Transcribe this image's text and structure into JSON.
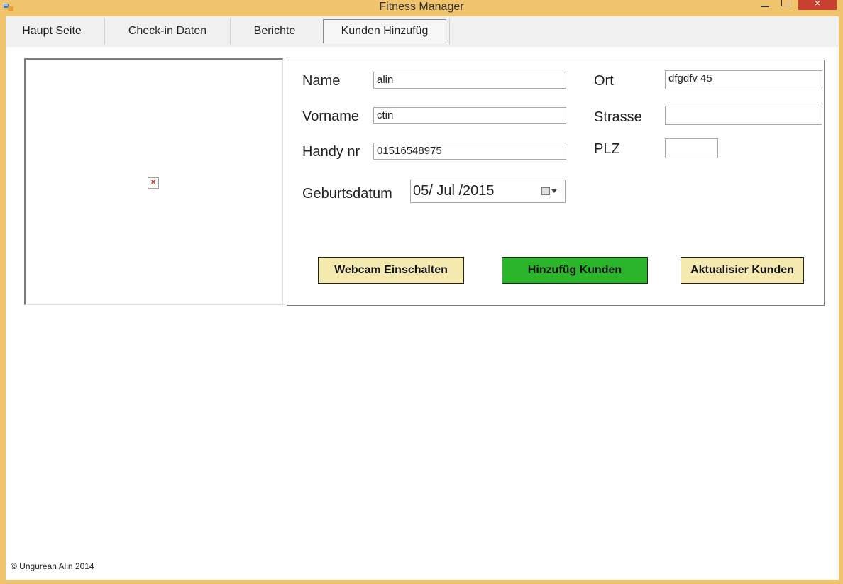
{
  "window": {
    "title": "Fitness Manager",
    "close_glyph": "×"
  },
  "tabs": [
    {
      "label": "Haupt Seite"
    },
    {
      "label": "Check-in Daten"
    },
    {
      "label": "Berichte"
    },
    {
      "label": "Kunden Hinzufüg",
      "active": true
    }
  ],
  "photo": {
    "broken_image_glyph": "×"
  },
  "form": {
    "name_label": "Name",
    "name_value": "alin",
    "vorname_label": "Vorname",
    "vorname_value": "ctin",
    "handy_label": "Handy nr",
    "handy_value": "01516548975",
    "geburtsdatum_label": "Geburtsdatum",
    "geburtsdatum_value": "05/ Jul /2015",
    "ort_label": "Ort",
    "ort_value": "dfgdfv 45",
    "strasse_label": "Strasse",
    "strasse_value": "",
    "plz_label": "PLZ",
    "plz_value": ""
  },
  "buttons": {
    "webcam": "Webcam Einschalten",
    "add": "Hinzufüg Kunden",
    "update": "Aktualisier Kunden"
  },
  "footer": {
    "copyright": "© Ungurean Alin 2014"
  },
  "colors": {
    "window_frame": "#f0c46c",
    "close_button": "#c8402f",
    "yellow_button": "#f4eab0",
    "green_button": "#2bb52b"
  },
  "icons": [
    "app-icon",
    "minimize-icon",
    "maximize-icon",
    "close-icon",
    "broken-image-icon",
    "calendar-icon",
    "dropdown-arrow-icon"
  ]
}
